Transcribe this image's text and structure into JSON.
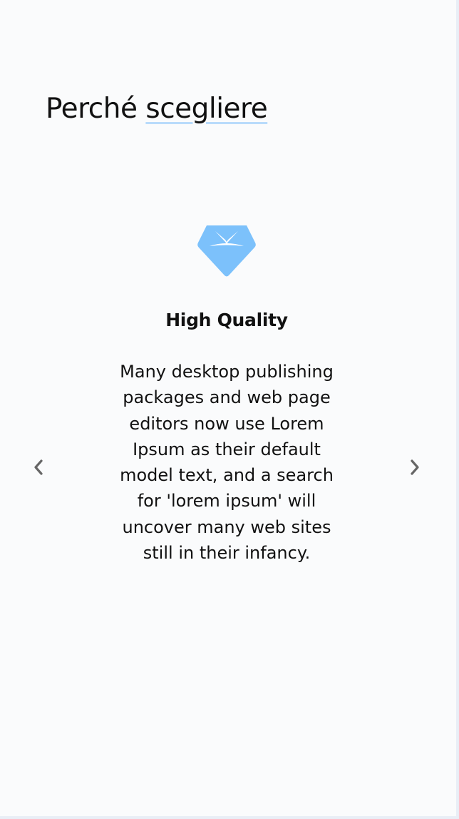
{
  "section": {
    "title_prefix": "Perché",
    "title_highlight": "scegliere"
  },
  "carousel": {
    "current_slide": {
      "icon": "diamond-icon",
      "title": "High Quality",
      "text": "Many desktop publishing packages and web page editors now use Lorem Ipsum as their default model text, and a search for 'lorem ipsum' will uncover many web sites still in their infancy."
    },
    "prev_icon": "chevron-left-icon",
    "next_icon": "chevron-right-icon"
  },
  "colors": {
    "accent": "#7cc1fb",
    "underline": "#b9dbfb",
    "background": "#fafbfc",
    "arrow": "#666666"
  }
}
